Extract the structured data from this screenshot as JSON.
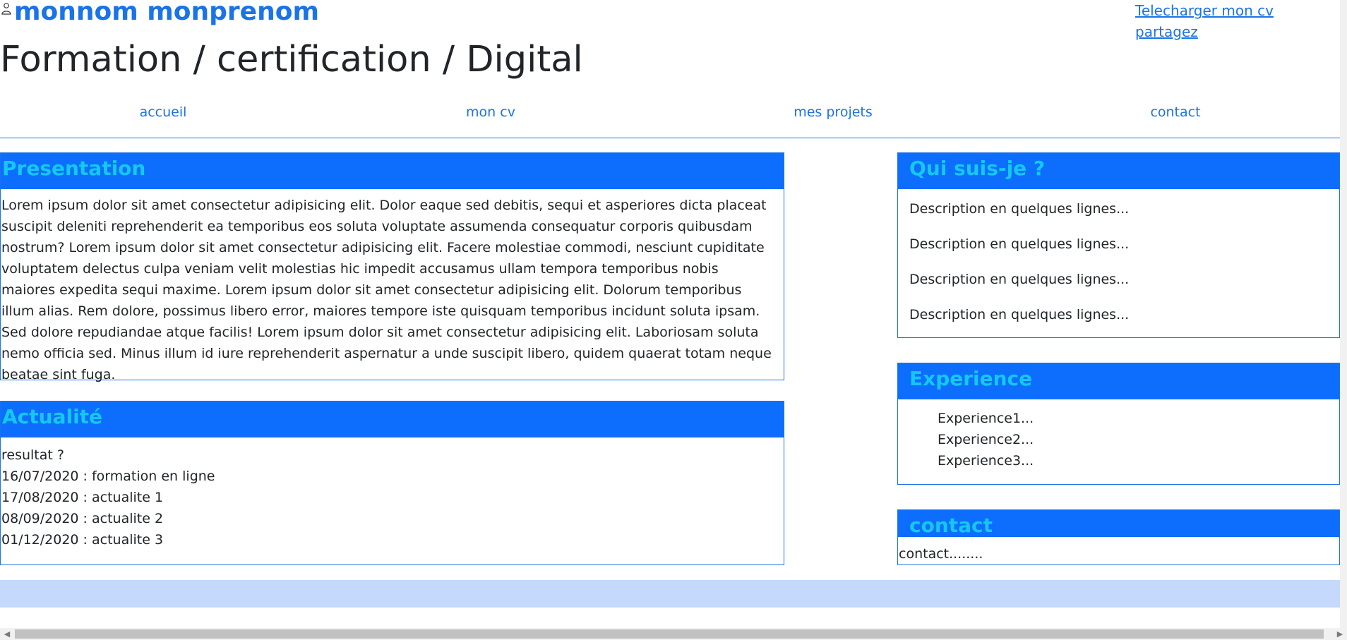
{
  "header": {
    "name": "monnom monprenom",
    "subtitle": "Formation / certification / Digital",
    "download_link": "Telecharger mon cv",
    "share_link": "partagez"
  },
  "nav": {
    "items": [
      "accueil",
      "mon cv",
      "mes projets",
      "contact"
    ]
  },
  "presentation": {
    "title": "Presentation",
    "text": "Lorem ipsum dolor sit amet consectetur adipisicing elit. Dolor eaque sed debitis, sequi et asperiores dicta placeat suscipit deleniti reprehenderit ea temporibus eos soluta voluptate assumenda consequatur corporis quibusdam nostrum? Lorem ipsum dolor sit amet consectetur adipisicing elit. Facere molestiae commodi, nesciunt cupiditate voluptatem delectus culpa veniam velit molestias hic impedit accusamus ullam tempora temporibus nobis maiores expedita sequi maxime. Lorem ipsum dolor sit amet consectetur adipisicing elit. Dolorum temporibus illum alias. Rem dolore, possimus libero error, maiores tempore iste quisquam temporibus incidunt soluta ipsam. Sed dolore repudiandae atque facilis! Lorem ipsum dolor sit amet consectetur adipisicing elit. Laboriosam soluta nemo officia sed. Minus illum id iure reprehenderit aspernatur a unde suscipit libero, quidem quaerat totam neque beatae sint fuga."
  },
  "actualite": {
    "title": "Actualité",
    "lines": [
      "resultat ?",
      "16/07/2020 : formation en ligne",
      "17/08/2020 : actualite 1",
      "08/09/2020 : actualite 2",
      "01/12/2020 : actualite 3"
    ]
  },
  "qui": {
    "title": "Qui suis-je ?",
    "lines": [
      "Description en quelques lignes...",
      "Description en quelques lignes...",
      "Description en quelques lignes...",
      "Description en quelques lignes..."
    ]
  },
  "experience": {
    "title": "Experience",
    "items": [
      "Experience1...",
      "Experience2...",
      "Experience3..."
    ]
  },
  "contact": {
    "title": "contact",
    "text": "contact........"
  },
  "colors": {
    "link": "#1a73e8",
    "panel_header_bg": "#0d6efd",
    "panel_header_text": "#14c8f0",
    "footer_band": "#c4d9fb"
  },
  "icons": {
    "user": "person-icon",
    "scroll_left": "scroll-left-arrow",
    "scroll_right": "scroll-right-arrow"
  }
}
